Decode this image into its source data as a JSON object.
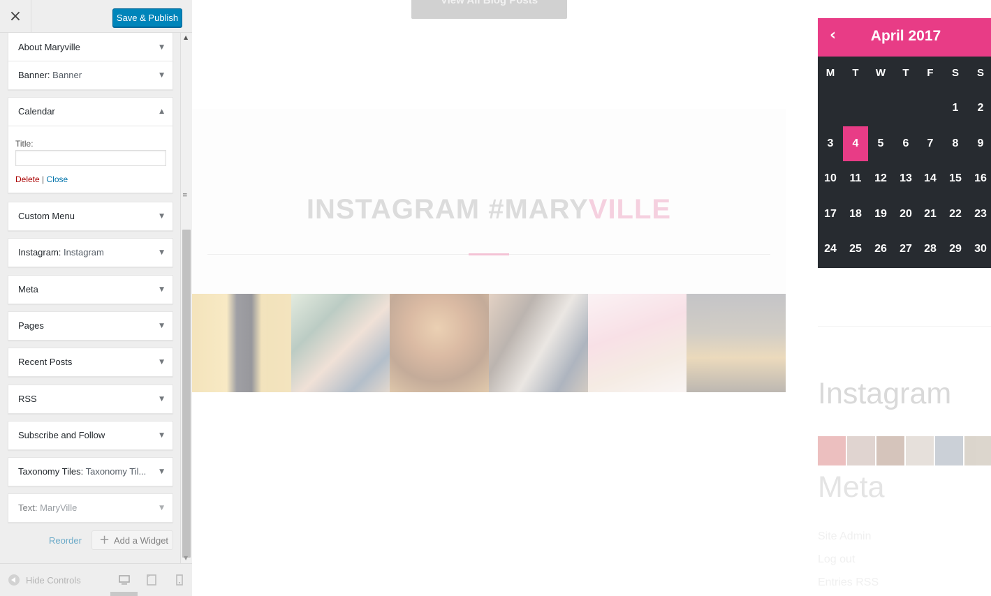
{
  "header": {
    "close_icon": "×",
    "save_label": "Save & Publish"
  },
  "widgets": [
    {
      "title": "About Maryville",
      "subtitle": "",
      "toggle": "▼"
    },
    {
      "title": "Banner:",
      "subtitle": "Banner",
      "toggle": "▼"
    },
    {
      "title": "Calendar",
      "subtitle": "",
      "toggle": "▲"
    },
    {
      "title": "Custom Menu",
      "subtitle": "",
      "toggle": "▼"
    },
    {
      "title": "Instagram:",
      "subtitle": "Instagram",
      "toggle": "▼"
    },
    {
      "title": "Meta",
      "subtitle": "",
      "toggle": "▼"
    },
    {
      "title": "Pages",
      "subtitle": "",
      "toggle": "▼"
    },
    {
      "title": "Recent Posts",
      "subtitle": "",
      "toggle": "▼"
    },
    {
      "title": "RSS",
      "subtitle": "",
      "toggle": "▼"
    },
    {
      "title": "Subscribe and Follow",
      "subtitle": "",
      "toggle": "▼"
    },
    {
      "title": "Taxonomy Tiles:",
      "subtitle": "Taxonomy Til...",
      "toggle": "▼"
    },
    {
      "title": "Text:",
      "subtitle": "MaryVille",
      "toggle": "▼"
    }
  ],
  "calendar_form": {
    "title_label": "Title:",
    "title_value": "",
    "delete_label": "Delete",
    "separator": "|",
    "close_label": "Close"
  },
  "actions": {
    "reorder_label": "Reorder",
    "add_widget_icon": "+",
    "add_widget_label": "Add a Widget"
  },
  "scrollbar": {
    "up_arrow": "▲",
    "down_arrow": "▼",
    "grip": "≡"
  },
  "footer": {
    "hide_controls_label": "Hide Controls",
    "devices": [
      "desktop-icon",
      "tablet-icon",
      "mobile-icon"
    ]
  },
  "preview": {
    "blog_button": "View All Blog Posts",
    "instagram_heading_main": "INSTAGRAM #MARY",
    "instagram_heading_accent": "VILLE",
    "instagram_widget_title": "Instagram",
    "meta_title": "Meta",
    "meta_links": [
      "Site Admin",
      "Log out",
      "Entries RSS"
    ]
  },
  "calendar": {
    "prev_icon": "‹",
    "month": "April 2017",
    "weekdays": [
      "M",
      "T",
      "W",
      "T",
      "F",
      "S",
      "S"
    ],
    "weeks": [
      [
        "",
        "",
        "",
        "",
        "",
        "1",
        "2"
      ],
      [
        "3",
        "4",
        "5",
        "6",
        "7",
        "8",
        "9"
      ],
      [
        "10",
        "11",
        "12",
        "13",
        "14",
        "15",
        "16"
      ],
      [
        "17",
        "18",
        "19",
        "20",
        "21",
        "22",
        "23"
      ],
      [
        "24",
        "25",
        "26",
        "27",
        "28",
        "29",
        "30"
      ]
    ],
    "today": "4"
  },
  "colors": {
    "primary_button": "#0085ba",
    "accent_pink": "#e83c86",
    "calendar_bg": "#272b30",
    "delete_red": "#aa0000",
    "link_blue": "#0073aa"
  }
}
